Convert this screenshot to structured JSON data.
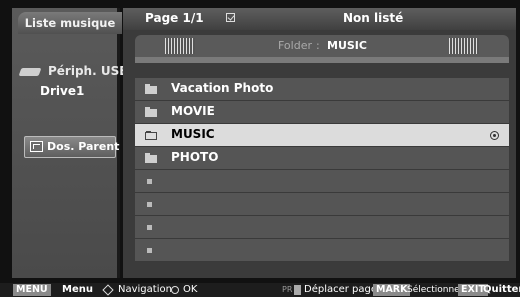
{
  "sidebar": {
    "tab_label": "Liste musique",
    "device_line1": "Périph. USB",
    "device_line2": "Drive1",
    "parent_button": "Dos. Parent"
  },
  "header": {
    "page": "Page 1/1",
    "status": "Non listé"
  },
  "folder_bar": {
    "label": "Folder",
    "separator": ":",
    "value": "MUSIC"
  },
  "list": {
    "items": [
      {
        "name": "Vacation Photo",
        "type": "folder",
        "selected": false
      },
      {
        "name": "MOVIE",
        "type": "folder",
        "selected": false
      },
      {
        "name": "MUSIC",
        "type": "folder",
        "selected": true
      },
      {
        "name": "PHOTO",
        "type": "folder",
        "selected": false
      },
      {
        "name": "",
        "type": "empty"
      },
      {
        "name": "",
        "type": "empty"
      },
      {
        "name": "",
        "type": "empty"
      },
      {
        "name": "",
        "type": "empty"
      }
    ]
  },
  "bottom_bar": {
    "menu_key": "MENU",
    "menu_label": "Menu",
    "nav_label": "Navigation",
    "ok_label": "OK",
    "pr_label": "PR",
    "page_label": "Déplacer page",
    "mark_key": "MARK",
    "mark_label": "Sélectionner",
    "exit_key": "EXIT",
    "exit_label": "Quitter"
  },
  "icons": {
    "usb": "usb-drive-icon",
    "parent": "parent-folder-icon",
    "check": "checkbox-icon",
    "folder": "folder-icon",
    "mark": "radio-mark-icon",
    "nav": "navigation-diamond-icon",
    "ok": "ok-circle-icon"
  }
}
